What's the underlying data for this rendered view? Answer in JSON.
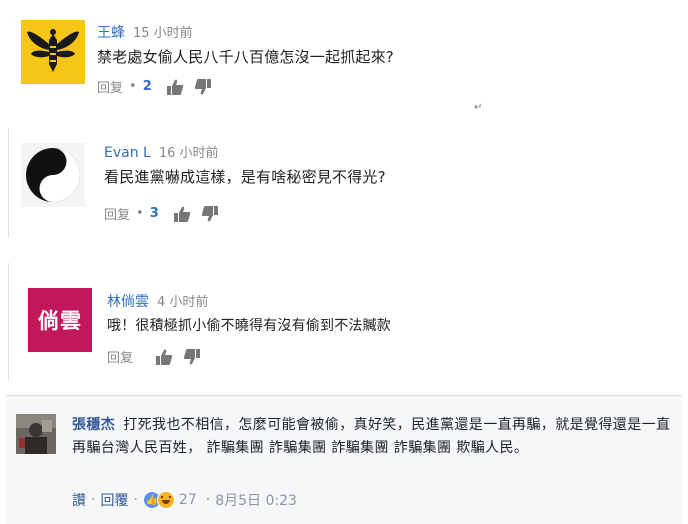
{
  "comments": [
    {
      "author": "王蜂",
      "time": "15 小时前",
      "text": "禁老處女偷人民八千八百億怎沒一起抓起來?",
      "reply_label": "回复",
      "separator": "•",
      "reply_count": "2",
      "avatar_icon": "bee-icon"
    },
    {
      "author": "Evan L",
      "time": "16 小时前",
      "text": "看民進黨嚇成這樣，是有啥秘密見不得光?",
      "reply_label": "回复",
      "separator": "•",
      "reply_count": "3",
      "avatar_icon": "yin-yang-icon"
    },
    {
      "author": "林倘雲",
      "time": "4 小时前",
      "text": "哦！很積極抓小偷不曉得有沒有偷到不法贓款",
      "reply_label": "回复",
      "avatar_text": "倘雲",
      "avatar_color": "#c2185b"
    }
  ],
  "stray_mark": "↵",
  "fb_comment": {
    "author": "張穩杰",
    "text": "打死我也不相信，怎麼可能會被偷，真好笑，民進黨還是一直再騙，就是覺得還是一直再騙台灣人民百姓， 詐騙集團 詐騙集團 詐騙集團 詐騙集團 欺騙人民。",
    "like_label": "讚",
    "sep": "·",
    "reply_label": "回覆",
    "reaction_count": "27",
    "date": "8月5日 0:23"
  },
  "colors": {
    "link_blue": "#2f6fbf",
    "fb_blue": "#365899",
    "muted": "#888888"
  }
}
